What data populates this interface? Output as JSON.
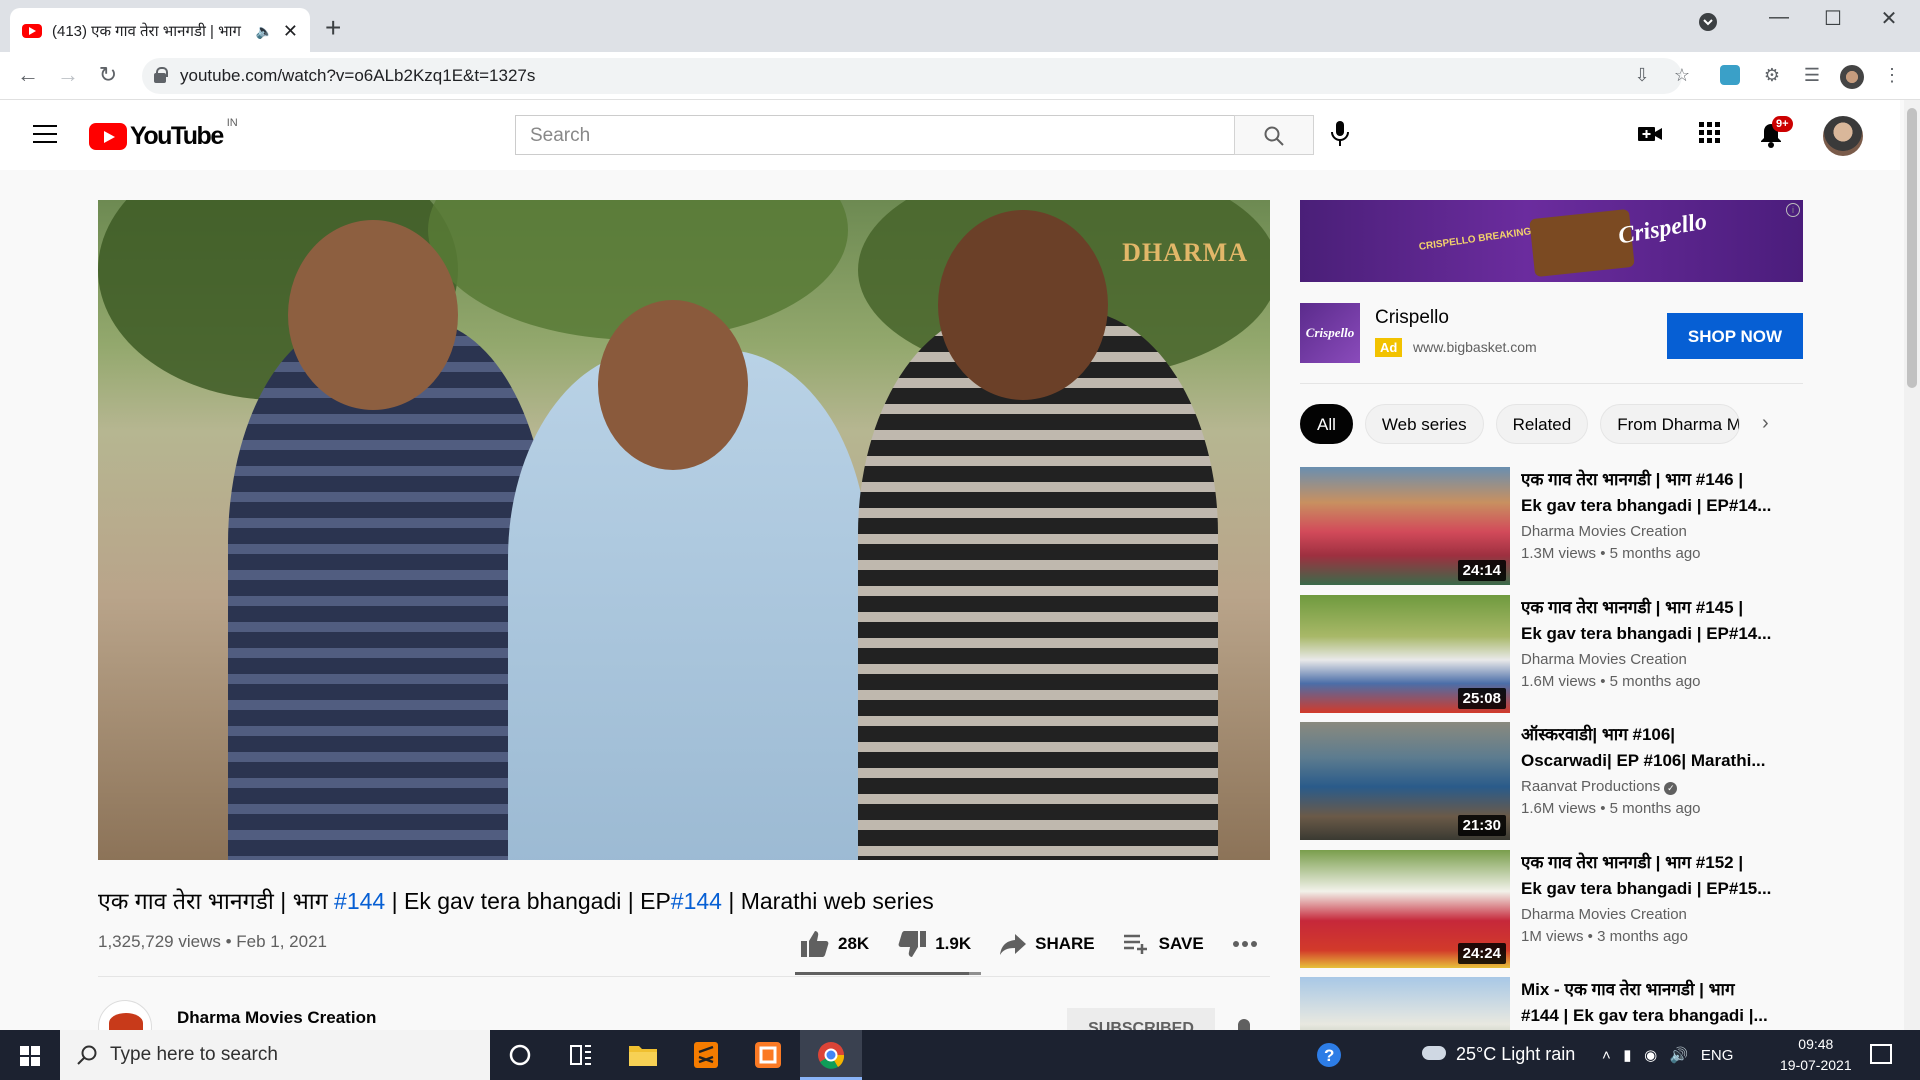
{
  "browser": {
    "tab_title": "(413) एक गाव तेरा भानगडी | भाग",
    "new_tab": "+",
    "url": "youtube.com/watch?v=o6ALb2Kzq1E&t=1327s"
  },
  "youtube": {
    "logo_text": "YouTube",
    "country_code": "IN",
    "search_placeholder": "Search",
    "notification_count": "9+"
  },
  "video": {
    "title_parts": [
      "एक गाव तेरा भानगडी | भाग ",
      "#144",
      " | Ek gav tera bhangadi | EP",
      "#144",
      " | Marathi web series"
    ],
    "watermark": "DHARMA",
    "views_date": "1,325,729 views • Feb 1, 2021",
    "likes": "28K",
    "dislikes": "1.9K",
    "like_ratio": 0.937,
    "share_label": "SHARE",
    "save_label": "SAVE",
    "channel_name": "Dharma Movies Creation",
    "subscribe_label": "SUBSCRIBED"
  },
  "ad": {
    "banner_text": "CRISPELLO BREAKING EQUAL SHARING",
    "banner_brand": "Crispello",
    "logo_text": "Crispello",
    "title": "Crispello",
    "badge": "Ad",
    "url": "www.bigbasket.com",
    "cta": "SHOP NOW"
  },
  "chips": [
    "All",
    "Web series",
    "Related",
    "From Dharma M"
  ],
  "recommendations": [
    {
      "title1": "एक गाव तेरा भानगडी | भाग #146 |",
      "title2": "Ek gav tera bhangadi | EP#14...",
      "channel": "Dharma Movies Creation",
      "meta": "1.3M views • 5 months ago",
      "duration": "24:14"
    },
    {
      "title1": "एक गाव तेरा भानगडी | भाग #145 |",
      "title2": "Ek gav tera bhangadi | EP#14...",
      "channel": "Dharma Movies Creation",
      "meta": "1.6M views • 5 months ago",
      "duration": "25:08"
    },
    {
      "title1": "ऑस्करवाडी| भाग #106|",
      "title2": "Oscarwadi| EP #106| Marathi...",
      "channel": "Raanvat Productions",
      "meta": "1.6M views • 5 months ago",
      "duration": "21:30"
    },
    {
      "title1": "एक गाव तेरा भानगडी | भाग #152 |",
      "title2": "Ek gav tera bhangadi | EP#15...",
      "channel": "Dharma Movies Creation",
      "meta": "1M views • 3 months ago",
      "duration": "24:24"
    },
    {
      "title1": "Mix - एक गाव तेरा भानगडी | भाग",
      "title2": "#144 | Ek gav tera bhangadi |...",
      "channel": "",
      "meta": "",
      "duration": ""
    }
  ],
  "taskbar": {
    "search_placeholder": "Type here to search",
    "weather": "25°C  Light rain",
    "language": "ENG",
    "time": "09:48",
    "date": "19-07-2021"
  },
  "colors": {
    "youtube_red": "#ff0000",
    "link_blue": "#065fd4",
    "taskbar": "#1c2230"
  }
}
